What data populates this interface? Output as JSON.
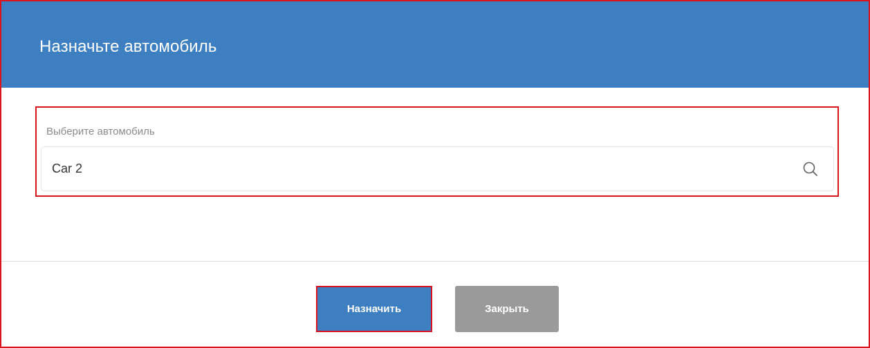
{
  "dialog": {
    "title": "Назначьте автомобиль",
    "colors": {
      "header": "#3d7fc1",
      "highlight": "#d9141c",
      "primary_button": "#3d7fc1",
      "secondary_button": "#9a9a9a"
    }
  },
  "car_field": {
    "label": "Выберите автомобиль",
    "value": "Car 2",
    "icon": "search-icon"
  },
  "buttons": {
    "assign_label": "Назначить",
    "close_label": "Закрыть"
  }
}
